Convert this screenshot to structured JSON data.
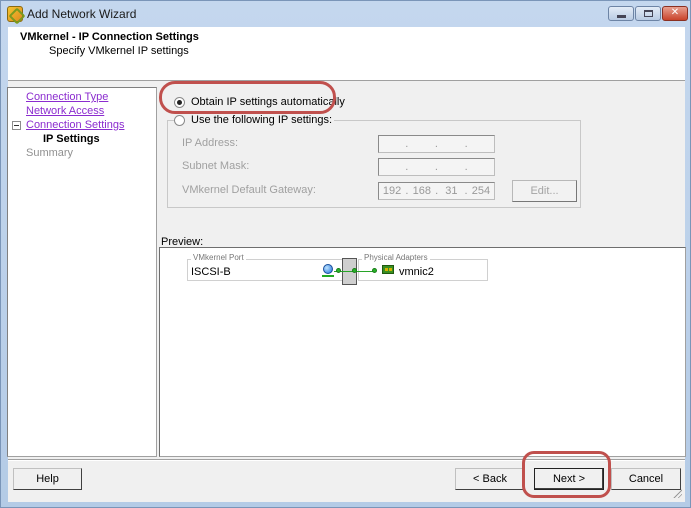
{
  "window": {
    "title": "Add Network Wizard",
    "controls": {
      "minimize": "minimize",
      "maximize": "maximize",
      "close": "close"
    }
  },
  "header": {
    "title": "VMkernel - IP Connection Settings",
    "subtitle": "Specify VMkernel IP settings"
  },
  "nav": {
    "items": [
      {
        "label": "Connection Type",
        "state": "link"
      },
      {
        "label": "Network Access",
        "state": "link"
      },
      {
        "label": "Connection Settings",
        "state": "link",
        "expanded": true
      },
      {
        "label": "IP Settings",
        "state": "current"
      },
      {
        "label": "Summary",
        "state": "disabled"
      }
    ]
  },
  "ip_settings": {
    "option_auto": {
      "label": "Obtain IP settings automatically",
      "selected": true
    },
    "option_static": {
      "label": "Use the following IP settings:",
      "selected": false
    },
    "fields": {
      "ip_address": {
        "label": "IP Address:",
        "octets": [
          "",
          "",
          "",
          ""
        ]
      },
      "subnet_mask": {
        "label": "Subnet Mask:",
        "octets": [
          "",
          "",
          "",
          ""
        ]
      },
      "gateway": {
        "label": "VMkernel Default Gateway:",
        "octets": [
          "192",
          "168",
          "31",
          "254"
        ]
      }
    },
    "edit_button": "Edit...",
    "octet_separator": "."
  },
  "preview": {
    "label": "Preview:",
    "vmkernel_port": {
      "legend": "VMkernel Port",
      "name": "ISCSI-B"
    },
    "physical_adapters": {
      "legend": "Physical Adapters",
      "name": "vmnic2"
    }
  },
  "footer": {
    "help": "Help",
    "back": "< Back",
    "next": "Next >",
    "cancel": "Cancel"
  },
  "annotations": {
    "highlight_color": "#c0504d"
  }
}
